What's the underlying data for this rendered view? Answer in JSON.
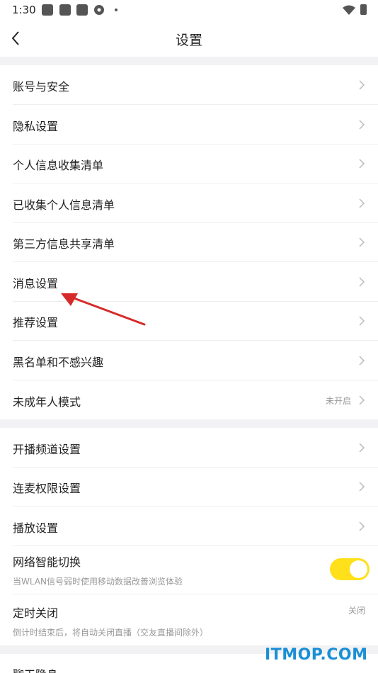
{
  "status_bar": {
    "time": "1:30"
  },
  "header": {
    "title": "设置"
  },
  "group1": [
    {
      "label": "账号与安全"
    },
    {
      "label": "隐私设置"
    },
    {
      "label": "个人信息收集清单"
    },
    {
      "label": "已收集个人信息清单"
    },
    {
      "label": "第三方信息共享清单"
    },
    {
      "label": "消息设置"
    },
    {
      "label": "推荐设置"
    },
    {
      "label": "黑名单和不感兴趣"
    },
    {
      "label": "未成年人模式",
      "value": "未开启"
    }
  ],
  "group2": [
    {
      "label": "开播频道设置"
    },
    {
      "label": "连麦权限设置"
    },
    {
      "label": "播放设置"
    }
  ],
  "network_switch": {
    "label": "网络智能切换",
    "description": "当WLAN信号弱时使用移动数据改善浏览体验",
    "enabled": true
  },
  "timer": {
    "label": "定时关闭",
    "value": "关闭",
    "description": "倒计时结束后，将自动关闭直播（交友直播间除外）"
  },
  "partial_row": {
    "label": "聊天隐身"
  },
  "watermark": "ITMOP.COM",
  "colors": {
    "toggle_on": "#ffe01a",
    "arrow": "#d62a2a",
    "watermark": "#1b8fd6",
    "separator": "#f2f2f4"
  }
}
